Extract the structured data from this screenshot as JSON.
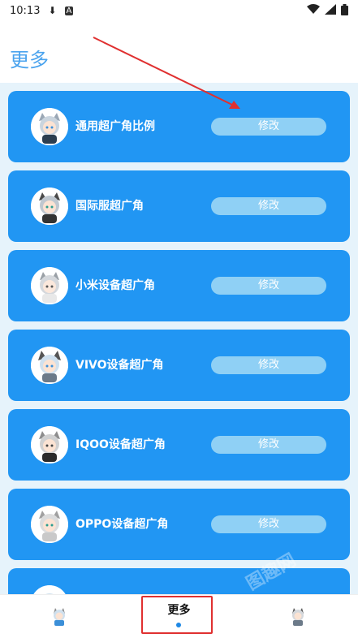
{
  "status_bar": {
    "time": "10:13",
    "download_icon": "download-icon",
    "text_icon": "A"
  },
  "header": {
    "title": "更多"
  },
  "cards": [
    {
      "label": "通用超广角比例",
      "button": "修改"
    },
    {
      "label": "国际服超广角",
      "button": "修改"
    },
    {
      "label": "小米设备超广角",
      "button": "修改"
    },
    {
      "label": "VIVO设备超广角",
      "button": "修改"
    },
    {
      "label": "IQOO设备超广角",
      "button": "修改"
    },
    {
      "label": "OPPO设备超广角",
      "button": "修改"
    },
    {
      "label": "",
      "button": ""
    }
  ],
  "watermark": "图趣网",
  "bottom_nav": {
    "tabs": [
      {
        "label": "",
        "icon": "character-avatar-icon"
      },
      {
        "label": "更多",
        "icon": ""
      },
      {
        "label": "",
        "icon": "character-avatar-icon"
      }
    ],
    "active_index": 1
  },
  "colors": {
    "accent": "#2196f3",
    "title": "#4aa3ee",
    "list_background": "#e6f3fb",
    "button": "#8fd0f5",
    "annotation": "#e03030"
  }
}
